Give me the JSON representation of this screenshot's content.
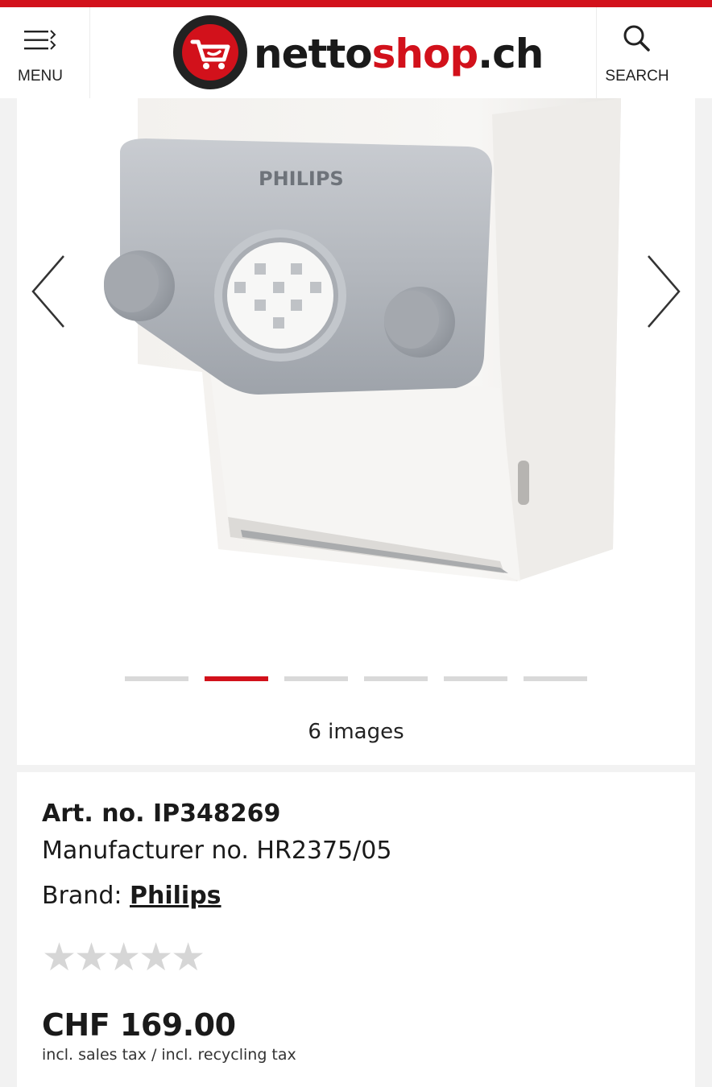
{
  "header": {
    "menu_label": "MENU",
    "search_label": "SEARCH",
    "logo_dark": "netto",
    "logo_red": "shop",
    "logo_suffix": ".ch",
    "accent_color": "#d2111b"
  },
  "gallery": {
    "product_brand_print": "PHILIPS",
    "image_count_text": "6 images",
    "total_images": 6,
    "active_index": 2,
    "prev_icon": "chevron-left-icon",
    "next_icon": "chevron-right-icon"
  },
  "product": {
    "art_no": "Art. no. IP348269",
    "manufacturer_no": "Manufacturer no. HR2375/05",
    "brand_prefix": "Brand: ",
    "brand_name": "Philips",
    "rating_stars": "★★★★★",
    "rating_value": 0,
    "price": "CHF 169.00",
    "tax_note": "incl. sales tax / incl. recycling tax"
  }
}
